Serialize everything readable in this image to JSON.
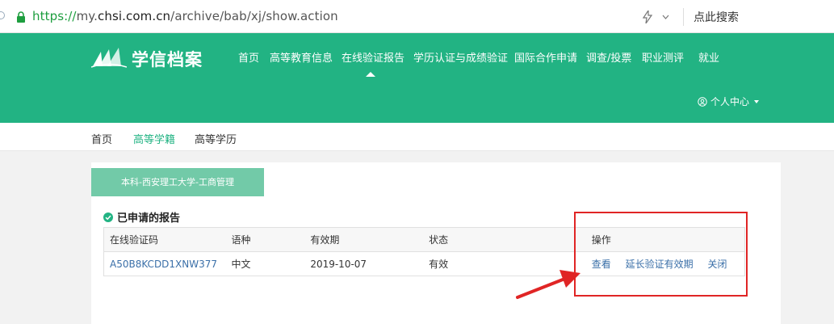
{
  "browser": {
    "url_protocol": "https://",
    "url_host_pre": "my.",
    "url_host_domain": "chsi.com.cn",
    "url_path": "/archive/bab/xj/show.action",
    "quick_search_label": "点此搜索"
  },
  "header": {
    "logo_text": "学信档案",
    "nav": [
      {
        "label": "首页"
      },
      {
        "label": "高等教育信息"
      },
      {
        "label": "在线验证报告"
      },
      {
        "label": "学历认证与成绩验证"
      },
      {
        "label": "国际合作申请"
      },
      {
        "label": "调查/投票"
      },
      {
        "label": "职业测评"
      },
      {
        "label": "就业"
      }
    ],
    "user_center_label": "个人中心"
  },
  "sub_nav": {
    "items": [
      {
        "label": "首页"
      },
      {
        "label": "高等学籍"
      },
      {
        "label": "高等学历"
      }
    ]
  },
  "panel": {
    "school_tab_label": "本科-西安理工大学-工商管理",
    "section_title": "已申请的报告",
    "table": {
      "headers": [
        "在线验证码",
        "语种",
        "有效期",
        "状态",
        "操作"
      ],
      "rows": [
        {
          "code": "A50B8KCDD1XNW377",
          "language": "中文",
          "expiry": "2019-10-07",
          "status": "有效",
          "actions": [
            "查看",
            "延长验证有效期",
            "关闭"
          ]
        }
      ]
    }
  },
  "colors": {
    "header_green": "#22b383",
    "tab_green": "#72caa8",
    "link_blue": "#3a6fa8",
    "annotation_red": "#e02525"
  }
}
